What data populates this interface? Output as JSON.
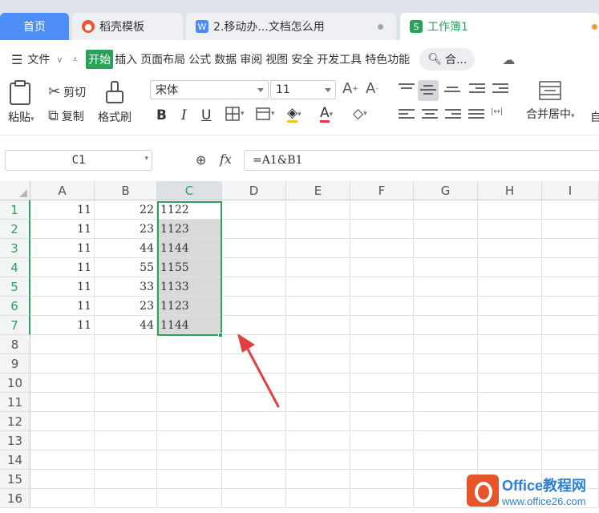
{
  "tabs": {
    "home": "首页",
    "doc1": "稻壳模板",
    "doc2": "2.移动办...文档怎么用",
    "active": "工作簿1"
  },
  "menu": {
    "file": "文件",
    "items": [
      "开始",
      "插入",
      "页面布局",
      "公式",
      "数据",
      "审阅",
      "视图",
      "安全",
      "开发工具",
      "特色功能"
    ],
    "search": "合..."
  },
  "ribbon": {
    "paste": "粘贴",
    "cut": "剪切",
    "copy": "复制",
    "format_painter": "格式刷",
    "font_name": "宋体",
    "font_size": "11",
    "merge_center": "合并居中",
    "auto_wrap": "自"
  },
  "formula_bar": {
    "cell_ref": "C1",
    "fx": "fx",
    "formula": "=A1&B1"
  },
  "grid": {
    "columns": [
      "A",
      "B",
      "C",
      "D",
      "E",
      "F",
      "G",
      "H",
      "I"
    ],
    "rows": [
      "1",
      "2",
      "3",
      "4",
      "5",
      "6",
      "7",
      "8",
      "9",
      "10",
      "11",
      "12",
      "13",
      "14",
      "15",
      "16"
    ],
    "data": [
      [
        "11",
        "22",
        "1122"
      ],
      [
        "11",
        "23",
        "1123"
      ],
      [
        "11",
        "44",
        "1144"
      ],
      [
        "11",
        "55",
        "1155"
      ],
      [
        "11",
        "33",
        "1133"
      ],
      [
        "11",
        "23",
        "1123"
      ],
      [
        "11",
        "44",
        "1144"
      ]
    ],
    "selected_column": "C",
    "accent": "#2ba25a"
  },
  "watermark": {
    "title": "Office教程网",
    "url": "www.office26.com"
  },
  "annotation_color": "#e24040"
}
